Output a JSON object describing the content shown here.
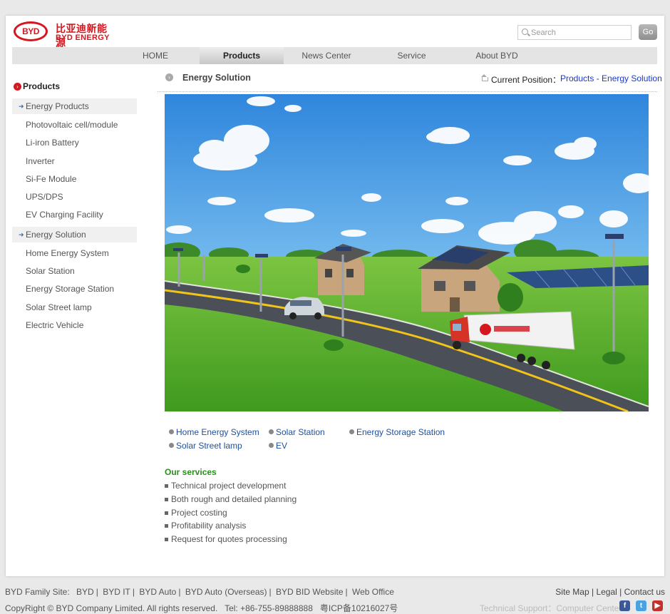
{
  "header": {
    "logo_text": "BYD",
    "logo_cn": "比亚迪新能源",
    "logo_en": "BYD ENERGY",
    "search_placeholder": "Search",
    "go_label": "Go"
  },
  "nav": [
    {
      "label": "HOME",
      "active": false
    },
    {
      "label": "Products",
      "active": true
    },
    {
      "label": "News Center",
      "active": false
    },
    {
      "label": "Service",
      "active": false
    },
    {
      "label": "About BYD",
      "active": false
    }
  ],
  "sidebar": {
    "title": "Products",
    "items": [
      {
        "label": "Energy Products",
        "category": true
      },
      {
        "label": "Photovoltaic cell/module",
        "category": false
      },
      {
        "label": "Li-iron Battery",
        "category": false
      },
      {
        "label": "Inverter",
        "category": false
      },
      {
        "label": "Si-Fe Module",
        "category": false
      },
      {
        "label": "UPS/DPS",
        "category": false
      },
      {
        "label": "EV Charging Facility",
        "category": false
      },
      {
        "label": "Energy Solution",
        "category": true
      },
      {
        "label": "Home Energy System",
        "category": false
      },
      {
        "label": "Solar Station",
        "category": false
      },
      {
        "label": "Energy Storage Station",
        "category": false
      },
      {
        "label": "Solar Street lamp",
        "category": false
      },
      {
        "label": "Electric Vehicle",
        "category": false
      }
    ]
  },
  "content": {
    "title": "Energy Solution",
    "position_label": "Current Position：",
    "position_path": "Products - Energy Solution",
    "quick_links": [
      "Home Energy System",
      "Solar Station",
      "Energy Storage Station",
      "Solar Street lamp",
      "EV"
    ],
    "services_title": "Our services",
    "services": [
      "Technical project development",
      "Both rough and detailed planning",
      "Project costing",
      "Profitability analysis",
      "Request for quotes processing"
    ]
  },
  "footer": {
    "family_label": "BYD Family Site:",
    "family_links": [
      "BYD",
      "BYD IT",
      "BYD Auto",
      "BYD Auto (Overseas)",
      "BYD BID Website",
      "Web Office"
    ],
    "right_links": [
      "Site Map",
      "Legal",
      "Contact us"
    ],
    "copyright": "CopyRight © BYD Company Limited. All rights reserved.",
    "tel": "Tel: +86-755-89888888",
    "icp": "粤ICP备10216027号",
    "tech_support": "Technical Support：Computer Center",
    "social": [
      "facebook-icon",
      "twitter-icon",
      "youtube-icon"
    ]
  },
  "colors": {
    "brand_red": "#d5171f",
    "link_blue": "#1f4f9c",
    "services_green": "#2b8c1e"
  }
}
